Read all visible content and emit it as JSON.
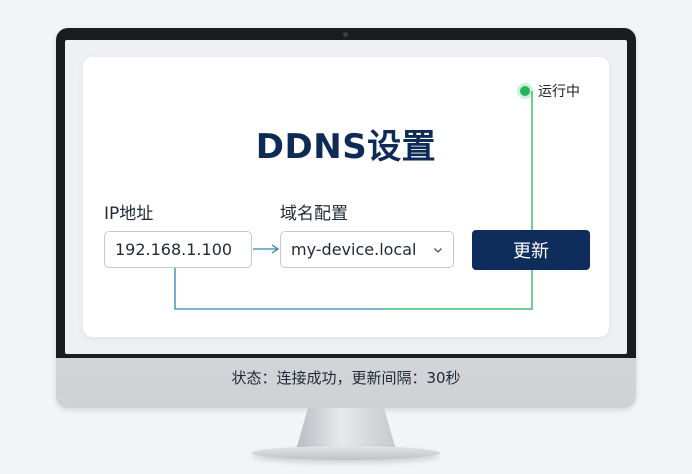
{
  "page": {
    "title": "DDNS设置",
    "status_indicator": {
      "text": "运行中",
      "color": "#22b55c"
    }
  },
  "form": {
    "ip_label": "IP地址",
    "ip_value": "192.168.1.100",
    "domain_label": "域名配置",
    "domain_value": "my-device.local",
    "update_button": "更新"
  },
  "footer": {
    "status_text": "状态：连接成功，更新间隔：30秒"
  },
  "colors": {
    "accent": "#0f2d5c",
    "title": "#0e2a57",
    "connector_blue": "#2d86b5",
    "connector_green": "#22b55c",
    "status_green": "#22b55c"
  },
  "icons": {
    "status": "status-dot-icon",
    "dropdown": "chevron-down-icon",
    "arrow": "arrow-right-icon"
  }
}
